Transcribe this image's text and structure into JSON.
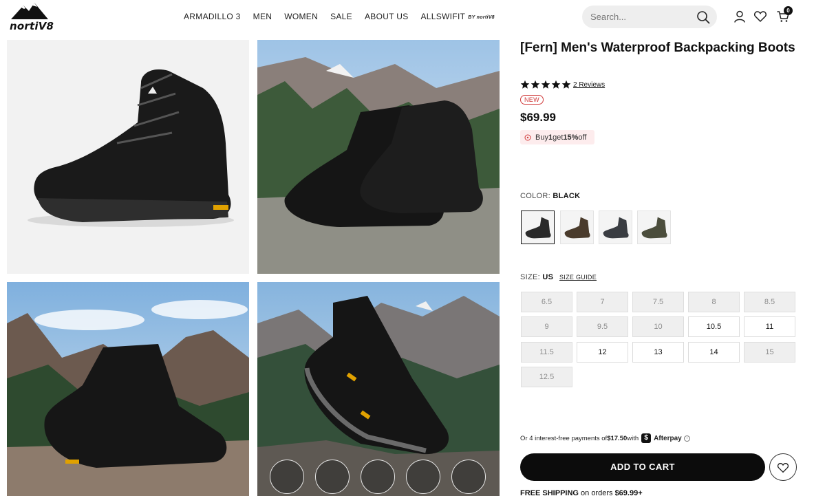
{
  "header": {
    "logo_text": "nortiV8",
    "nav": [
      {
        "label": "ARMADILLO 3"
      },
      {
        "label": "MEN"
      },
      {
        "label": "WOMEN"
      },
      {
        "label": "SALE"
      },
      {
        "label": "ABOUT US"
      },
      {
        "label": "ALLSWIFIT",
        "badge": "BY nortiV8"
      }
    ],
    "search_placeholder": "Search...",
    "cart_count": "0",
    "icons": [
      "search-icon",
      "account-icon",
      "heart-icon",
      "cart-icon"
    ]
  },
  "gallery": {
    "images": [
      {
        "name": "boot-studio-angle"
      },
      {
        "name": "boots-pair-mountain"
      },
      {
        "name": "boot-side-mountain"
      },
      {
        "name": "boot-sole-rock"
      }
    ],
    "feature_icons": [
      "pattern-1-icon",
      "pattern-2-icon",
      "pattern-3-icon",
      "pattern-4-icon",
      "pattern-5-icon"
    ]
  },
  "product": {
    "title": "[Fern] Men's Waterproof Backpacking Boots",
    "rating": 5,
    "reviews": "2 Reviews",
    "badge": "NEW",
    "price": "$69.99",
    "promo": {
      "pre": "Buy ",
      "qty": "1",
      "mid": " get ",
      "pct": "15%",
      "post": " off"
    },
    "color_label": "COLOR:",
    "color_value": "BLACK",
    "swatches": [
      {
        "name": "black",
        "color": "#2a2a2a",
        "selected": true
      },
      {
        "name": "brown",
        "color": "#4a3b2c",
        "selected": false
      },
      {
        "name": "gray",
        "color": "#3a3d42",
        "selected": false
      },
      {
        "name": "olive",
        "color": "#4b4d3c",
        "selected": false
      }
    ],
    "size_label": "SIZE:",
    "size_unit": "US",
    "size_guide": "SIZE GUIDE",
    "sizes": [
      {
        "label": "6.5",
        "available": false
      },
      {
        "label": "7",
        "available": false
      },
      {
        "label": "7.5",
        "available": false
      },
      {
        "label": "8",
        "available": false
      },
      {
        "label": "8.5",
        "available": false
      },
      {
        "label": "9",
        "available": false
      },
      {
        "label": "9.5",
        "available": false
      },
      {
        "label": "10",
        "available": false
      },
      {
        "label": "10.5",
        "available": true
      },
      {
        "label": "11",
        "available": true
      },
      {
        "label": "11.5",
        "available": false
      },
      {
        "label": "12",
        "available": true
      },
      {
        "label": "13",
        "available": true
      },
      {
        "label": "14",
        "available": true
      },
      {
        "label": "15",
        "available": false
      },
      {
        "label": "12.5",
        "available": false
      }
    ],
    "afterpay": {
      "pre": "Or 4 interest-free payments of ",
      "amount": "$17.50",
      "mid": " with",
      "logo": "$",
      "name": "Afterpay",
      "info": "i"
    },
    "add_to_cart": "ADD TO CART",
    "free_shipping": {
      "label": "FREE SHIPPING",
      "mid": " on orders ",
      "amount": "$69.99+"
    }
  }
}
